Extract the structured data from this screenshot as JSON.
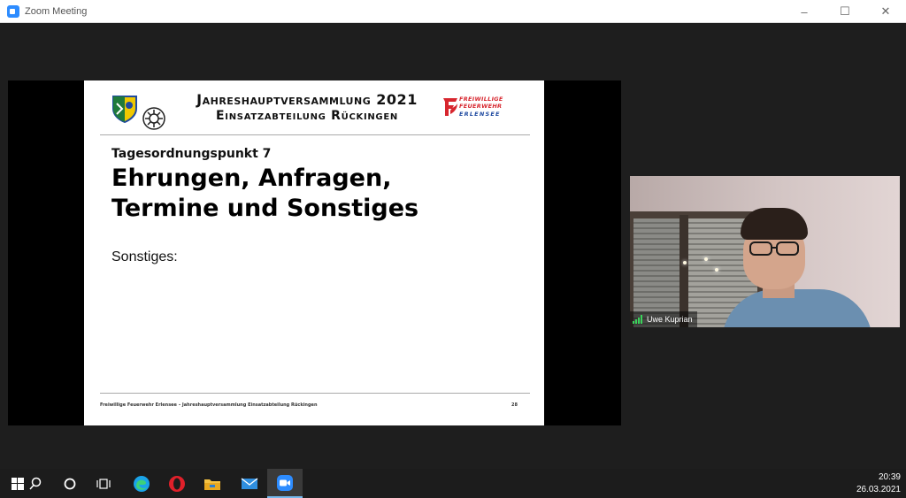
{
  "window": {
    "title": "Zoom Meeting",
    "controls": {
      "minimize": "–",
      "maximize": "☐",
      "close": "✕"
    }
  },
  "slide": {
    "header_line1": "Jahreshauptversammlung 2021",
    "header_line2": "Einsatzabteilung Rückingen",
    "logo_line1": "FREIWILLIGE",
    "logo_line2": "FEUERWEHR",
    "logo_line3": "ERLENSEE",
    "agenda_item": "Tagesordnungspunkt 7",
    "heading_line1": "Ehrungen, Anfragen,",
    "heading_line2": "Termine und Sonstiges",
    "body": "Sonstiges:",
    "footer": "Freiwillige Feuerwehr Erlensee – Jahreshauptversammlung Einsatzabteilung Rückingen",
    "page_number": "28"
  },
  "participant": {
    "name": "Uwe Kuprian",
    "status_color": "#3ad35a"
  },
  "taskbar": {
    "time": "20:39",
    "date": "26.03.2021",
    "icons": [
      "windows-start-icon",
      "search-icon",
      "cortana-icon",
      "task-view-icon",
      "edge-icon",
      "opera-icon",
      "file-explorer-icon",
      "mail-icon",
      "zoom-icon"
    ]
  },
  "colors": {
    "zoom_blue": "#2d8cff",
    "feuerwehr_red": "#d7262e",
    "feuerwehr_blue": "#1f4aa0"
  }
}
